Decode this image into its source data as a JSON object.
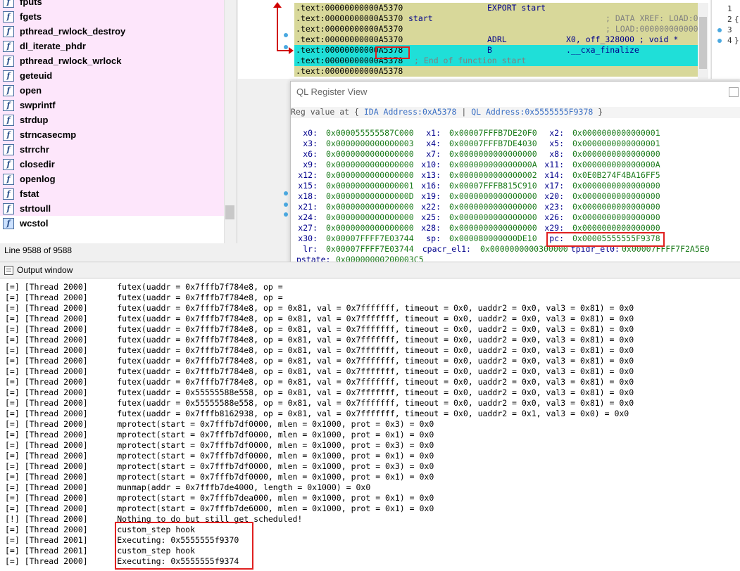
{
  "function_list": {
    "items": [
      {
        "label": "fputs",
        "selected": false
      },
      {
        "label": "fgets",
        "selected": false
      },
      {
        "label": "pthread_rwlock_destroy",
        "selected": false
      },
      {
        "label": "dl_iterate_phdr",
        "selected": false
      },
      {
        "label": "pthread_rwlock_wrlock",
        "selected": false
      },
      {
        "label": "geteuid",
        "selected": false
      },
      {
        "label": "open",
        "selected": false
      },
      {
        "label": "swprintf",
        "selected": false
      },
      {
        "label": "strdup",
        "selected": false
      },
      {
        "label": "strncasecmp",
        "selected": false
      },
      {
        "label": "strrchr",
        "selected": false
      },
      {
        "label": "closedir",
        "selected": false
      },
      {
        "label": "openlog",
        "selected": false
      },
      {
        "label": "fstat",
        "selected": false
      },
      {
        "label": "strtoull",
        "selected": false
      },
      {
        "label": "wcstol",
        "selected": true
      }
    ],
    "icon": "function-icon",
    "icon_glyph": "f",
    "status": "Line 9588 of 9588"
  },
  "disassembly": {
    "lines": [
      {
        "addr": ".text:00000000000A5370",
        "col2": "",
        "mnem": "EXPORT start",
        "ops": "",
        "cmt": "",
        "hl": "normal"
      },
      {
        "addr": ".text:00000000000A5370",
        "col2": "start",
        "mnem": "",
        "ops": "",
        "cmt": "; DATA XREF: LOAD:0",
        "hl": "normal"
      },
      {
        "addr": ".text:00000000000A5370",
        "col2": "",
        "mnem": "",
        "ops": "",
        "cmt": "; LOAD:000000000000",
        "hl": "normal"
      },
      {
        "addr": ".text:00000000000A5370",
        "col2": "",
        "mnem": "ADRL",
        "ops": "X0, off_328000 ; void *",
        "cmt": "",
        "hl": "normal"
      },
      {
        "addr": ".text:00000000000A5378",
        "col2": "",
        "mnem": "B",
        "ops": ".__cxa_finalize",
        "cmt": "",
        "hl": "cur"
      },
      {
        "addr": ".text:00000000000A5378",
        "col2": "",
        "mnem": "",
        "ops": "",
        "cmt": "; End of function start",
        "hl": "sub"
      },
      {
        "addr": ".text:00000000000A5378",
        "col2": "",
        "mnem": "",
        "ops": "",
        "cmt": "",
        "hl": "normal"
      }
    ],
    "arrow_color": "#d00000",
    "highlight_color": "#1fdfd8",
    "code_bg": "#d8d89a"
  },
  "right_pane": {
    "line_numbers": [
      "1",
      "2",
      "3",
      "4"
    ],
    "glyphs": [
      "",
      "{",
      "",
      "}"
    ]
  },
  "register_view": {
    "title": "QL Register View",
    "header_prefix": "Reg value at { ",
    "header_ida": "IDA Address:0xA5378",
    "header_sep": " | ",
    "header_ql": "QL Address:0x5555555F9378",
    "header_suffix": " }",
    "registers": [
      {
        "name": "x0:",
        "value": "0x000055555587C000"
      },
      {
        "name": "x1:",
        "value": "0x00007FFFB7DE20F0"
      },
      {
        "name": "x2:",
        "value": "0x0000000000000001"
      },
      {
        "name": "x3:",
        "value": "0x0000000000000003"
      },
      {
        "name": "x4:",
        "value": "0x00007FFFB7DE4030"
      },
      {
        "name": "x5:",
        "value": "0x0000000000000001"
      },
      {
        "name": "x6:",
        "value": "0x0000000000000000"
      },
      {
        "name": "x7:",
        "value": "0x0000000000000000"
      },
      {
        "name": "x8:",
        "value": "0x0000000000000000"
      },
      {
        "name": "x9:",
        "value": "0x0000000000000000"
      },
      {
        "name": "x10:",
        "value": "0x000000000000000A"
      },
      {
        "name": "x11:",
        "value": "0x000000000000000A"
      },
      {
        "name": "x12:",
        "value": "0x0000000000000000"
      },
      {
        "name": "x13:",
        "value": "0x0000000000000002"
      },
      {
        "name": "x14:",
        "value": "0x0E0B274F4BA16FF5"
      },
      {
        "name": "x15:",
        "value": "0x0000000000000001"
      },
      {
        "name": "x16:",
        "value": "0x00007FFFB815C910"
      },
      {
        "name": "x17:",
        "value": "0x0000000000000000"
      },
      {
        "name": "x18:",
        "value": "0x000000000000000D"
      },
      {
        "name": "x19:",
        "value": "0x0000000000000000"
      },
      {
        "name": "x20:",
        "value": "0x0000000000000000"
      },
      {
        "name": "x21:",
        "value": "0x0000000000000000"
      },
      {
        "name": "x22:",
        "value": "0x0000000000000000"
      },
      {
        "name": "x23:",
        "value": "0x0000000000000000"
      },
      {
        "name": "x24:",
        "value": "0x0000000000000000"
      },
      {
        "name": "x25:",
        "value": "0x0000000000000000"
      },
      {
        "name": "x26:",
        "value": "0x0000000000000000"
      },
      {
        "name": "x27:",
        "value": "0x0000000000000000"
      },
      {
        "name": "x28:",
        "value": "0x0000000000000000"
      },
      {
        "name": "x29:",
        "value": "0x0000000000000000"
      },
      {
        "name": "x30:",
        "value": "0x00007FFFF7E03744"
      },
      {
        "name": "sp:",
        "value": "0x000080000000DE10"
      },
      {
        "name": "pc:",
        "value": "0x00005555555F9378"
      },
      {
        "name": "lr:",
        "value": "0x00007FFFF7E03744"
      },
      {
        "name": "cpacr_el1:",
        "value": "0x0000000000300000"
      },
      {
        "name": "tpidr_el0:",
        "value": "0x00007FFFF7F2A5E0"
      },
      {
        "name": "pstate:",
        "value": "0x00000000200003C5"
      }
    ],
    "footer_value": "0"
  },
  "output_window": {
    "title": "Output window",
    "lines": [
      "[=] [Thread 2000]      futex(uaddr = 0x7fffb7f784e8, op =",
      "[=] [Thread 2000]      futex(uaddr = 0x7fffb7f784e8, op =",
      "[=] [Thread 2000]      futex(uaddr = 0x7fffb7f784e8, op = 0x81, val = 0x7fffffff, timeout = 0x0, uaddr2 = 0x0, val3 = 0x81) = 0x0",
      "[=] [Thread 2000]      futex(uaddr = 0x7fffb7f784e8, op = 0x81, val = 0x7fffffff, timeout = 0x0, uaddr2 = 0x0, val3 = 0x81) = 0x0",
      "[=] [Thread 2000]      futex(uaddr = 0x7fffb7f784e8, op = 0x81, val = 0x7fffffff, timeout = 0x0, uaddr2 = 0x0, val3 = 0x81) = 0x0",
      "[=] [Thread 2000]      futex(uaddr = 0x7fffb7f784e8, op = 0x81, val = 0x7fffffff, timeout = 0x0, uaddr2 = 0x0, val3 = 0x81) = 0x0",
      "[=] [Thread 2000]      futex(uaddr = 0x7fffb7f784e8, op = 0x81, val = 0x7fffffff, timeout = 0x0, uaddr2 = 0x0, val3 = 0x81) = 0x0",
      "[=] [Thread 2000]      futex(uaddr = 0x7fffb7f784e8, op = 0x81, val = 0x7fffffff, timeout = 0x0, uaddr2 = 0x0, val3 = 0x81) = 0x0",
      "[=] [Thread 2000]      futex(uaddr = 0x7fffb7f784e8, op = 0x81, val = 0x7fffffff, timeout = 0x0, uaddr2 = 0x0, val3 = 0x81) = 0x0",
      "[=] [Thread 2000]      futex(uaddr = 0x7fffb7f784e8, op = 0x81, val = 0x7fffffff, timeout = 0x0, uaddr2 = 0x0, val3 = 0x81) = 0x0",
      "[=] [Thread 2000]      futex(uaddr = 0x55555588e558, op = 0x81, val = 0x7fffffff, timeout = 0x0, uaddr2 = 0x0, val3 = 0x81) = 0x0",
      "[=] [Thread 2000]      futex(uaddr = 0x55555588e558, op = 0x81, val = 0x7fffffff, timeout = 0x0, uaddr2 = 0x0, val3 = 0x81) = 0x0",
      "[=] [Thread 2000]      futex(uaddr = 0x7fffb8162938, op = 0x81, val = 0x7fffffff, timeout = 0x0, uaddr2 = 0x1, val3 = 0x0) = 0x0",
      "[=] [Thread 2000]      mprotect(start = 0x7fffb7df0000, mlen = 0x1000, prot = 0x3) = 0x0",
      "[=] [Thread 2000]      mprotect(start = 0x7fffb7df0000, mlen = 0x1000, prot = 0x1) = 0x0",
      "[=] [Thread 2000]      mprotect(start = 0x7fffb7df0000, mlen = 0x1000, prot = 0x3) = 0x0",
      "[=] [Thread 2000]      mprotect(start = 0x7fffb7df0000, mlen = 0x1000, prot = 0x1) = 0x0",
      "[=] [Thread 2000]      mprotect(start = 0x7fffb7df0000, mlen = 0x1000, prot = 0x3) = 0x0",
      "[=] [Thread 2000]      mprotect(start = 0x7fffb7df0000, mlen = 0x1000, prot = 0x1) = 0x0",
      "[=] [Thread 2000]      munmap(addr = 0x7fffb7de4000, length = 0x1000) = 0x0",
      "[=] [Thread 2000]      mprotect(start = 0x7fffb7dea000, mlen = 0x1000, prot = 0x1) = 0x0",
      "[=] [Thread 2000]      mprotect(start = 0x7fffb7de6000, mlen = 0x1000, prot = 0x1) = 0x0",
      "[!] [Thread 2000]      Nothing to do but still get scheduled!",
      "[=] [Thread 2000]      custom_step hook",
      "[=] [Thread 2001]      Executing: 0x5555555f9370",
      "[=] [Thread 2001]      custom_step hook",
      "[=] [Thread 2000]      Executing: 0x5555555f9374"
    ]
  }
}
